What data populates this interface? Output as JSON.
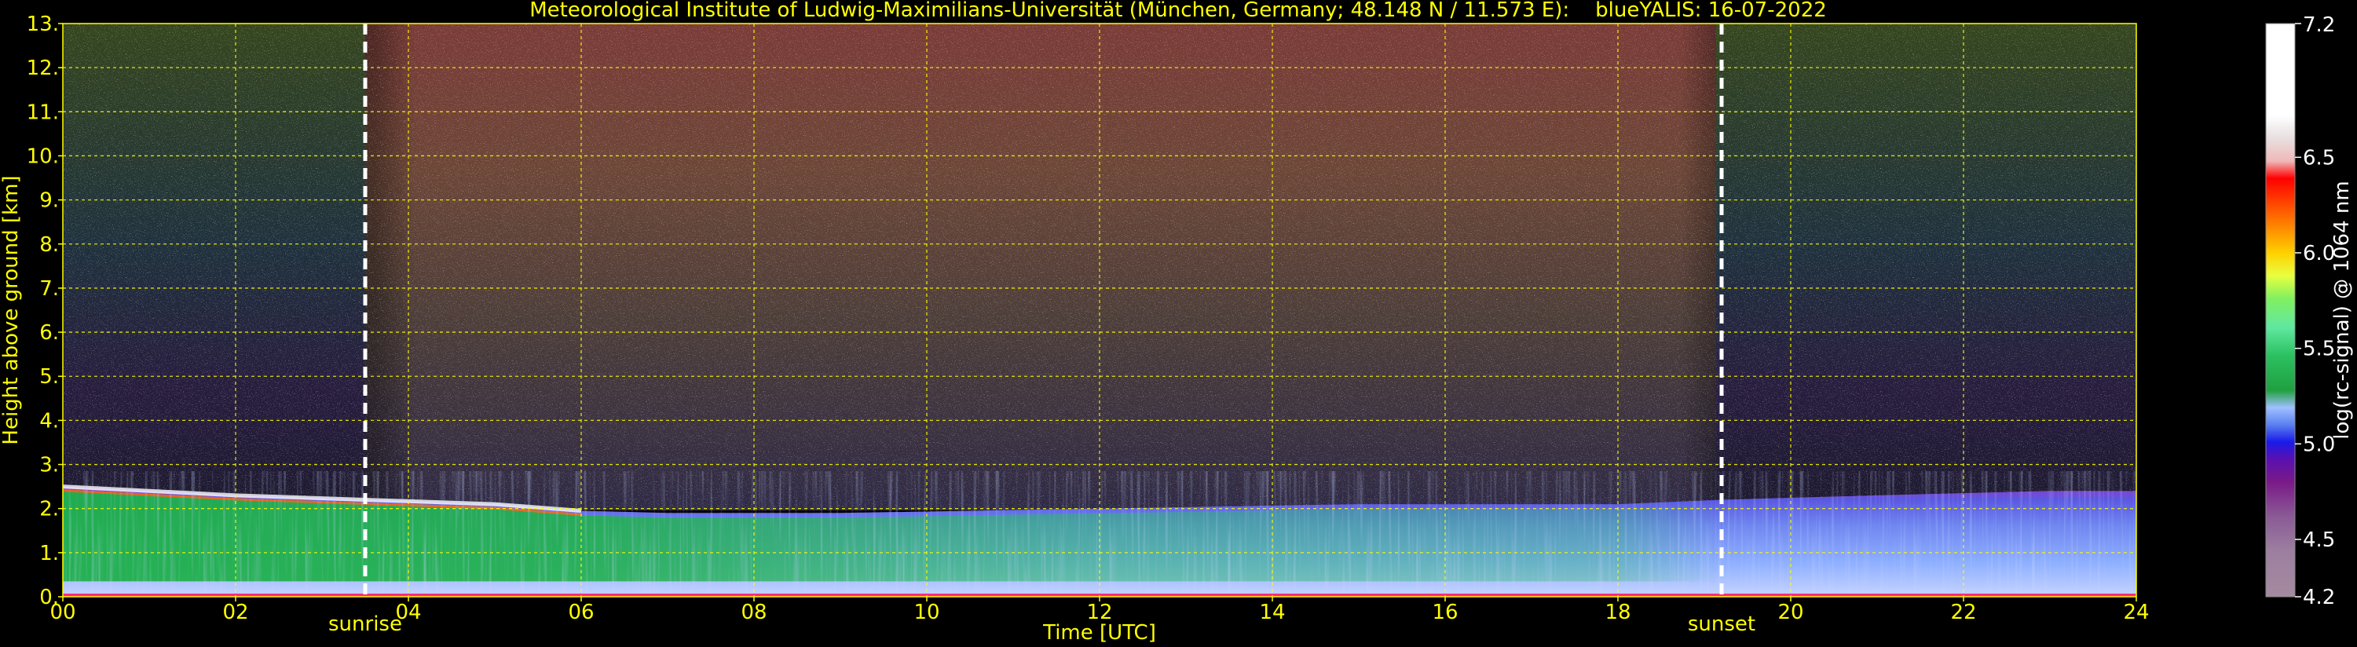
{
  "chart_data": {
    "type": "heatmap",
    "title": "Meteorological Institute of Ludwig-Maximilians-Universität (München, Germany; 48.148 N / 11.573 E):    blueYALIS: 16-07-2022",
    "xlabel": "Time [UTC]",
    "ylabel": "Height above ground [km]",
    "xlim": [
      0,
      24
    ],
    "ylim": [
      0,
      13
    ],
    "x_ticks": [
      "00",
      "02",
      "04",
      "06",
      "08",
      "10",
      "12",
      "14",
      "16",
      "18",
      "20",
      "22",
      "24"
    ],
    "y_ticks": [
      "0.",
      "1.",
      "2.",
      "3.",
      "4.",
      "5.",
      "6.",
      "7.",
      "8.",
      "9.",
      "10.",
      "11.",
      "12.",
      "13."
    ],
    "grid": true,
    "colorbar": {
      "label": "log(rc-signal) @ 1064 nm",
      "min": 4.2,
      "max": 7.2,
      "ticks": [
        "4.2",
        "4.5",
        "5.0",
        "5.5",
        "6.0",
        "6.5",
        "7.2"
      ]
    },
    "annotations": [
      {
        "label": "sunrise",
        "x": 3.5
      },
      {
        "label": "sunset",
        "x": 19.2
      }
    ],
    "features": {
      "boundary_layer_top_km": [
        {
          "x": 0,
          "y": 2.5
        },
        {
          "x": 1,
          "y": 2.4
        },
        {
          "x": 2,
          "y": 2.3
        },
        {
          "x": 3.5,
          "y": 2.2
        },
        {
          "x": 5,
          "y": 2.1
        },
        {
          "x": 6,
          "y": 1.95
        },
        {
          "x": 7,
          "y": 1.9
        },
        {
          "x": 9,
          "y": 1.9
        },
        {
          "x": 12,
          "y": 2.0
        },
        {
          "x": 15,
          "y": 2.1
        },
        {
          "x": 18,
          "y": 2.1
        },
        {
          "x": 19.2,
          "y": 2.2
        },
        {
          "x": 21,
          "y": 2.3
        },
        {
          "x": 23,
          "y": 2.4
        },
        {
          "x": 24,
          "y": 2.4
        }
      ]
    }
  },
  "colors": {
    "background": "#000000",
    "text": "#ffff00",
    "grid": "#ffff00",
    "marker_lines": "#ffffff",
    "colorbar_text": "#ffffff"
  }
}
